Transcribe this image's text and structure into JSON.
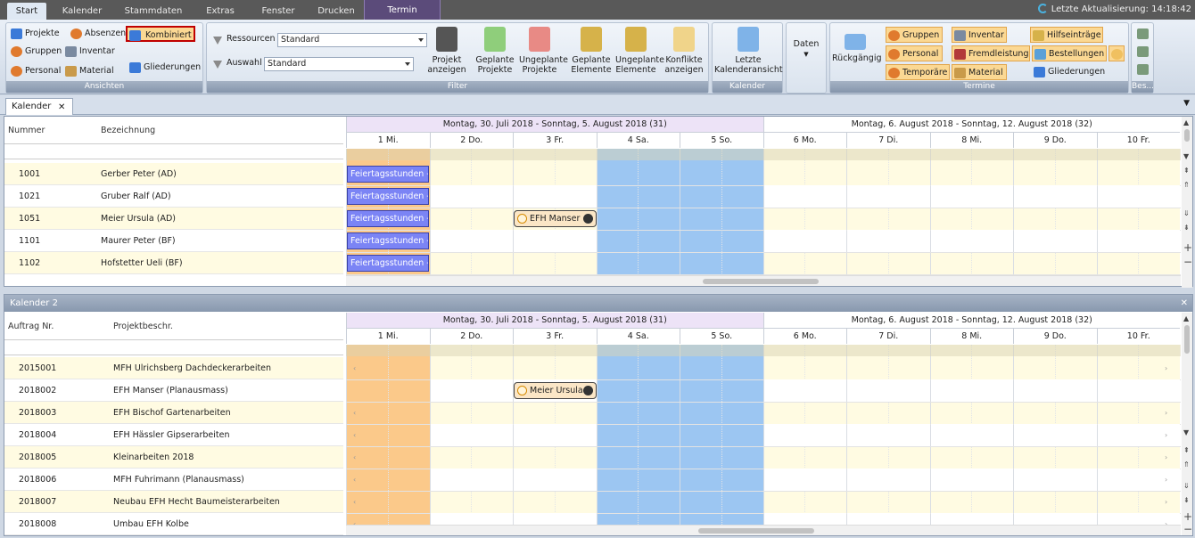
{
  "menu": {
    "tabs": [
      "Start",
      "Kalender",
      "Stammdaten",
      "Extras",
      "Fenster",
      "Drucken",
      "Termin"
    ],
    "last_update": "Letzte Aktualisierung: 14:18:42"
  },
  "ribbon": {
    "ansichten": {
      "caption": "Ansichten",
      "projekte": "Projekte",
      "absenzen": "Absenzen",
      "kombiniert": "Kombiniert",
      "gruppen": "Gruppen",
      "inventar": "Inventar",
      "personal": "Personal",
      "material": "Material",
      "gliederungen": "Gliederungen"
    },
    "filter": {
      "caption": "Filter",
      "ressourcen_label": "Ressourcen",
      "ressourcen_value": "Standard",
      "auswahl_label": "Auswahl",
      "auswahl_value": "Standard",
      "buttons": [
        {
          "l1": "Projekt",
          "l2": "anzeigen",
          "color": "#6b6b6b"
        },
        {
          "l1": "Geplante",
          "l2": "Projekte",
          "color": "#4caf50"
        },
        {
          "l1": "Ungeplante",
          "l2": "Projekte",
          "color": "#e53935"
        },
        {
          "l1": "Geplante",
          "l2": "Elemente",
          "color": "#4caf50"
        },
        {
          "l1": "Ungeplante",
          "l2": "Elemente",
          "color": "#e53935"
        },
        {
          "l1": "Konflikte",
          "l2": "anzeigen",
          "color": "#e0b23a"
        }
      ]
    },
    "kalender": {
      "caption": "Kalender",
      "l1": "Letzte",
      "l2": "Kalenderansicht"
    },
    "daten": {
      "label": "Daten"
    },
    "termine": {
      "caption": "Termine",
      "rueckgaengig": "Rückgängig",
      "gruppen": "Gruppen",
      "inventar": "Inventar",
      "hilfseintraege": "Hilfseinträge",
      "personal": "Personal",
      "fremdleistung": "Fremdleistung",
      "bestellungen": "Bestellungen",
      "temporaere": "Temporäre",
      "material": "Material",
      "gliederungen": "Gliederungen"
    },
    "bes_caption": "Bes..."
  },
  "doc_tab": {
    "label": "Kalender"
  },
  "calendar1": {
    "col_nummer": "Nummer",
    "col_bezeichnung": "Bezeichnung",
    "week1": "Montag, 30. Juli 2018 - Sonntag, 5. August 2018 (31)",
    "week2": "Montag, 6. August 2018 - Sonntag, 12. August 2018 (32)",
    "days": [
      "1 Mi.",
      "2 Do.",
      "3 Fr.",
      "4 Sa.",
      "5 So.",
      "6 Mo.",
      "7 Di.",
      "8 Mi.",
      "9 Do.",
      "10 Fr."
    ],
    "rows": [
      {
        "nr": "1001",
        "name": "Gerber Peter (AD)"
      },
      {
        "nr": "1021",
        "name": "Gruber Ralf (AD)"
      },
      {
        "nr": "1051",
        "name": "Meier Ursula (AD)"
      },
      {
        "nr": "1101",
        "name": "Maurer Peter (BF)"
      },
      {
        "nr": "1102",
        "name": "Hofstetter Ueli (BF)"
      }
    ],
    "feier_label": "Feiertagsstunden -",
    "appointment": "EFH Manser"
  },
  "calendar2": {
    "title": "Kalender 2",
    "col_auftrag": "Auftrag Nr.",
    "col_projekt": "Projektbeschr.",
    "week1": "Montag, 30. Juli 2018 - Sonntag, 5. August 2018 (31)",
    "week2": "Montag, 6. August 2018 - Sonntag, 12. August 2018 (32)",
    "days": [
      "1 Mi.",
      "2 Do.",
      "3 Fr.",
      "4 Sa.",
      "5 So.",
      "6 Mo.",
      "7 Di.",
      "8 Mi.",
      "9 Do.",
      "10 Fr."
    ],
    "rows": [
      {
        "nr": "2015001",
        "name": "MFH Ulrichsberg Dachdeckerarbeiten"
      },
      {
        "nr": "2018002",
        "name": "EFH Manser (Planausmass)"
      },
      {
        "nr": "2018003",
        "name": "EFH Bischof Gartenarbeiten"
      },
      {
        "nr": "2018004",
        "name": "EFH Hässler Gipserarbeiten"
      },
      {
        "nr": "2018005",
        "name": "Kleinarbeiten 2018"
      },
      {
        "nr": "2018006",
        "name": "MFH Fuhrimann (Planausmass)"
      },
      {
        "nr": "2018007",
        "name": "Neubau EFH Hecht Baumeisterarbeiten"
      },
      {
        "nr": "2018008",
        "name": "Umbau EFH Kolbe"
      }
    ],
    "appointment": "Meier Ursula"
  },
  "colors": {
    "today": "#fbc98a",
    "weekend": "#9cc6f2",
    "week_bg": "#ede3f7",
    "feier": "#7b84f5",
    "highlight": "#fbd893"
  }
}
